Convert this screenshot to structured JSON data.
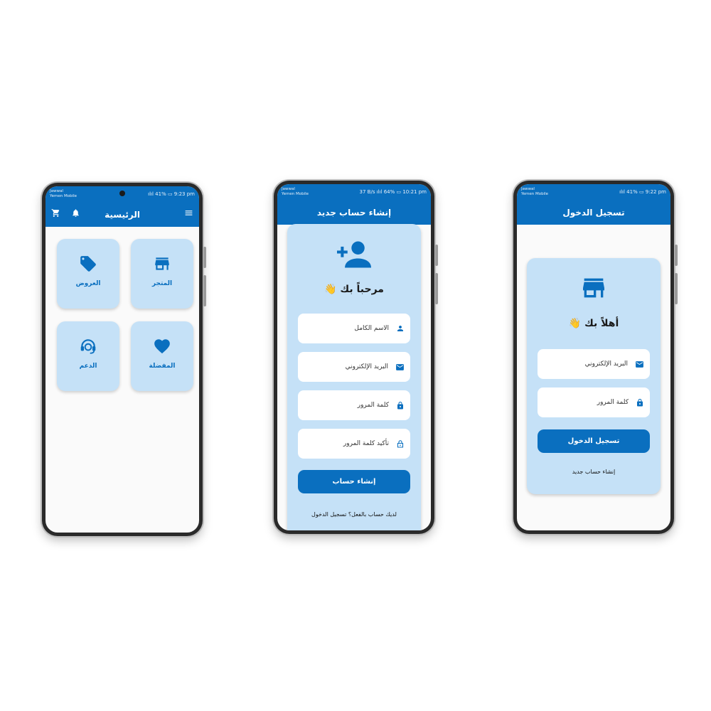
{
  "status": {
    "home": {
      "carrier": "Jawwal\nYemen Mobile",
      "right": "ılıl 41% ▭ 9:23 pm"
    },
    "signup": {
      "carrier": "Jawwal\nYemen Mobile",
      "right": "37 B/s ılıl 64% ▭ 10:21 pm"
    },
    "login": {
      "carrier": "Jawwal\nYemen Mobile",
      "right": "ılıl 41% ▭ 9:22 pm"
    }
  },
  "home": {
    "title": "الرئيسية",
    "tiles": {
      "store": "المتجر",
      "offers": "العروض",
      "favorites": "المفضلة",
      "support": "الدعم"
    }
  },
  "signup": {
    "title": "إنشاء حساب جديد",
    "welcome": "مرحباً بك 👋",
    "fields": {
      "full_name": "الاسم الكامل",
      "email": "البريد الإلكتروني",
      "password": "كلمة المرور",
      "confirm_password": "تأكيد كلمة المرور"
    },
    "submit": "إنشاء حساب",
    "login_link": "لديك حساب بالفعل؟ تسجيل الدخول"
  },
  "login": {
    "title": "تسجيل الدخول",
    "welcome": "أهلاً بك 👋",
    "fields": {
      "email": "البريد الإلكتروني",
      "password": "كلمة المرور"
    },
    "submit": "تسجيل الدخول",
    "signup_link": "إنشاء حساب جديد"
  },
  "colors": {
    "primary": "#0a6fbf",
    "card": "#c5e1f7",
    "background": "#fafafa"
  }
}
